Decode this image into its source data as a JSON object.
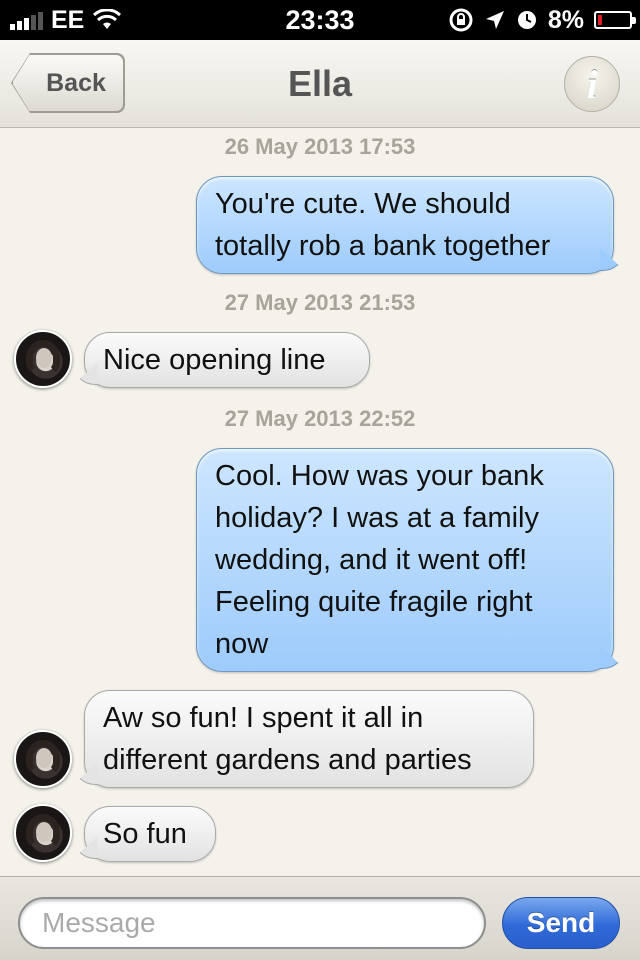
{
  "status_bar": {
    "carrier": "EE",
    "time": "23:33",
    "battery": "8%",
    "battery_level": 0.08,
    "icons": [
      "signal-icon",
      "wifi-icon",
      "rotation-lock-icon",
      "location-icon",
      "alarm-icon",
      "battery-icon"
    ]
  },
  "nav": {
    "back_label": "Back",
    "title": "Ella",
    "info_label": "i"
  },
  "conversation": [
    {
      "type": "timestamp",
      "text": "26 May 2013 17:53"
    },
    {
      "type": "outgoing",
      "lines": [
        "You're cute. We should",
        "totally rob a bank together"
      ]
    },
    {
      "type": "timestamp",
      "text": "27 May 2013 21:53"
    },
    {
      "type": "incoming",
      "lines": [
        "Nice opening line"
      ]
    },
    {
      "type": "timestamp",
      "text": "27 May 2013 22:52"
    },
    {
      "type": "outgoing",
      "lines": [
        "Cool. How was your bank",
        "holiday? I was at a family",
        "wedding, and it went off!",
        "Feeling quite fragile right",
        "now"
      ]
    },
    {
      "type": "incoming",
      "lines": [
        "Aw so fun! I spent it all in",
        "different gardens and parties"
      ]
    },
    {
      "type": "incoming",
      "lines": [
        "So fun"
      ]
    }
  ],
  "composer": {
    "placeholder": "Message",
    "value": "",
    "send_label": "Send"
  },
  "colors": {
    "outgoing_bubble": "#a9d2fc",
    "incoming_bubble": "#ececec",
    "send_button": "#2f6ad8",
    "background": "#f4f2ea"
  }
}
